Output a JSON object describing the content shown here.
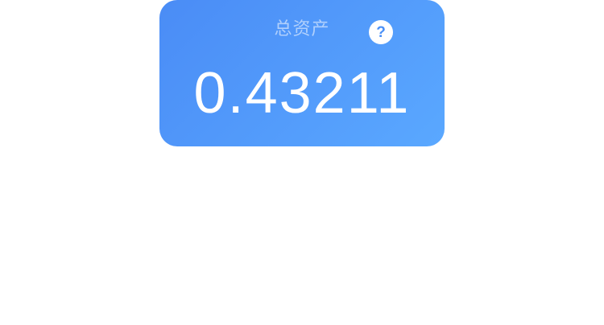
{
  "asset_card": {
    "title": "总资产",
    "help_glyph": "?",
    "help_icon": "question-mark-circle",
    "value": "0.43211",
    "gradient_start": "#4a8cf6",
    "gradient_end": "#5aa8ff"
  }
}
